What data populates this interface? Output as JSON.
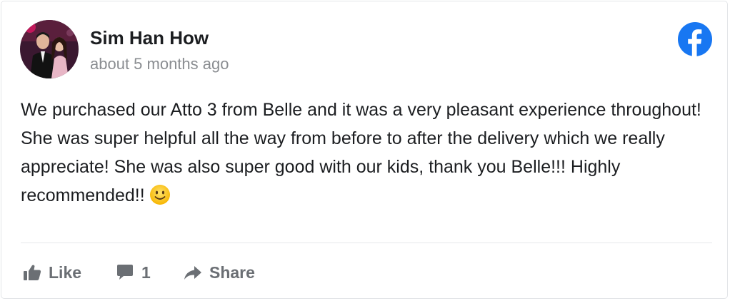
{
  "post": {
    "author_name": "Sim Han How",
    "timestamp": "about 5 months ago",
    "text": "We purchased our Atto 3 from Belle and it was a very pleasant experience throughout! She was super helpful all the way from before to after the delivery which we really appreciate! She was also super good with our kids, thank you Belle!!! Highly recommended!!",
    "emoji": "slightly-smiling-face"
  },
  "actions": {
    "like_label": "Like",
    "comment_count": "1",
    "share_label": "Share"
  },
  "icons": {
    "source": "facebook-icon",
    "like": "thumbs-up-icon",
    "comment": "comment-icon",
    "share": "share-arrow-icon"
  },
  "colors": {
    "facebook_blue": "#1877f2",
    "text": "#1c1e21",
    "muted": "#8a8d91",
    "action": "#6b6f74"
  }
}
